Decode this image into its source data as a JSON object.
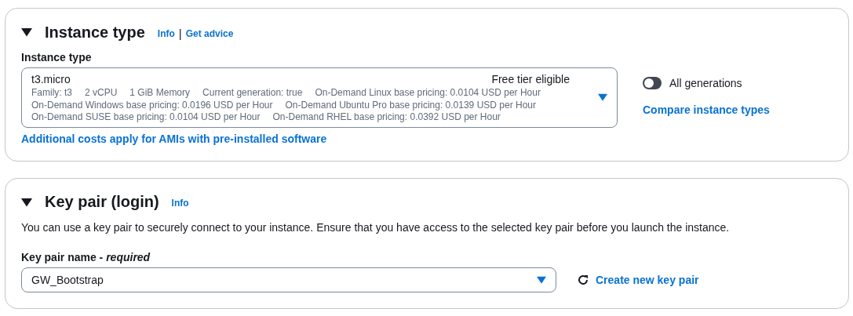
{
  "instance_type": {
    "title": "Instance type",
    "expanded": true,
    "info": "Info",
    "separator": "|",
    "get_advice": "Get advice",
    "field_label": "Instance type",
    "select": {
      "value": "t3.micro",
      "badge": "Free tier eligible",
      "details": [
        [
          "Family: t3",
          "2 vCPU",
          "1 GiB Memory",
          "Current generation: true",
          "On-Demand Linux base pricing: 0.0104 USD per Hour"
        ],
        [
          "On-Demand Windows base pricing: 0.0196 USD per Hour",
          "On-Demand Ubuntu Pro base pricing: 0.0139 USD per Hour"
        ],
        [
          "On-Demand SUSE base pricing: 0.0104 USD per Hour",
          "On-Demand RHEL base pricing: 0.0392 USD per Hour"
        ]
      ]
    },
    "note_link": "Additional costs apply for AMIs with pre-installed software",
    "toggle": {
      "label": "All generations",
      "on": false
    },
    "compare_link": "Compare instance types"
  },
  "key_pair": {
    "title": "Key pair (login)",
    "expanded": true,
    "info": "Info",
    "description": "You can use a key pair to securely connect to your instance. Ensure that you have access to the selected key pair before you launch the instance.",
    "field_label": "Key pair name - *required*",
    "select": {
      "value": "GW_Bootstrap"
    },
    "create_link": "Create new key pair"
  }
}
